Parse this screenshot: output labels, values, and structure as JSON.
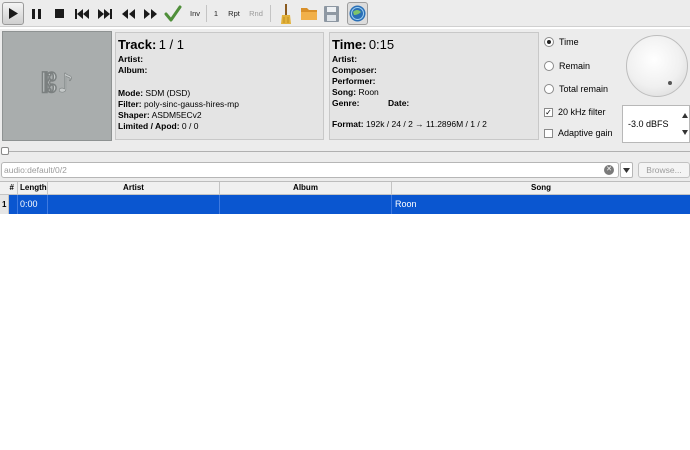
{
  "toolbar": {
    "inv_label": "Inv",
    "count_label": "1",
    "rpt_label": "Rpt",
    "rnd_label": "Rnd",
    "icons": [
      "play-icon",
      "pause-icon",
      "stop-icon",
      "previous-track-icon",
      "next-track-icon",
      "rewind-icon",
      "fast-forward-icon",
      "checkmark-icon",
      "broom-icon",
      "folder-icon",
      "save-icon",
      "globe-icon"
    ]
  },
  "track_panel": {
    "track_label": "Track:",
    "track_value": "1 / 1",
    "artist_label": "Artist:",
    "album_label": "Album:",
    "mode_label": "Mode:",
    "mode_value": "SDM (DSD)",
    "filter_label": "Filter:",
    "filter_value": "poly-sinc-gauss-hires-mp",
    "shaper_label": "Shaper:",
    "shaper_value": "ASDM5ECv2",
    "limited_label": "Limited / Apod:",
    "limited_value": "0 / 0"
  },
  "time_panel": {
    "time_label": "Time:",
    "time_value": "0:15",
    "artist_label": "Artist:",
    "composer_label": "Composer:",
    "performer_label": "Performer:",
    "song_label": "Song:",
    "song_value": "Roon",
    "genre_label": "Genre:",
    "date_label": "Date:",
    "format_label": "Format:",
    "format_value": "192k / 24 / 2 → 11.2896M / 1 / 2"
  },
  "display_options": {
    "time": "Time",
    "remain": "Remain",
    "total_remain": "Total remain",
    "selected": "Time"
  },
  "filters": {
    "khz20": "20 kHz filter",
    "khz20_checked": true,
    "adaptive_gain": "Adaptive gain",
    "adaptive_gain_checked": false
  },
  "volume": {
    "gain_value": "-3.0 dBFS"
  },
  "device": {
    "placeholder": "audio:default/0/2",
    "browse_label": "Browse..."
  },
  "playlist": {
    "columns": [
      "#",
      "Length",
      "Artist",
      "Album",
      "Song"
    ],
    "rows": [
      {
        "num": "1",
        "length": "0:00",
        "artist": "",
        "album": "",
        "song": "Roon"
      }
    ]
  },
  "colors": {
    "selection": "#0a56d0",
    "toolbar_bg": "#ececec",
    "cover_bg": "#a9adad"
  }
}
